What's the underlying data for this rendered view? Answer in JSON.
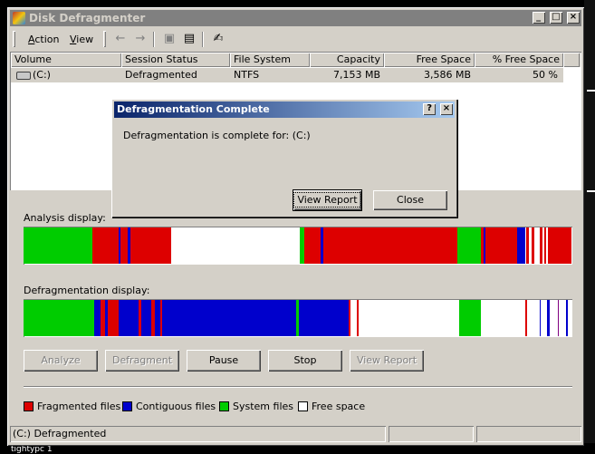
{
  "window": {
    "title": "Disk Defragmenter",
    "controls": [
      "_",
      "□",
      "×"
    ]
  },
  "menu": {
    "action": "Action",
    "view": "View"
  },
  "toolbar_icons": [
    "back-arrow-icon",
    "forward-arrow-icon",
    "folder-icon",
    "properties-icon",
    "help-icon"
  ],
  "list": {
    "columns": [
      "Volume",
      "Session Status",
      "File System",
      "Capacity",
      "Free Space",
      "% Free Space"
    ],
    "rows": [
      {
        "volume": "(C:)",
        "status": "Defragmented",
        "fs": "NTFS",
        "capacity": "7,153 MB",
        "free": "3,586 MB",
        "pct": "50 %"
      }
    ]
  },
  "analysis": {
    "label": "Analysis display:",
    "segments_note_percent": true,
    "segments": [
      [
        "#00cc00",
        0,
        12.5
      ],
      [
        "#dd0000",
        12.5,
        5
      ],
      [
        "#0000cc",
        17.3,
        0.4
      ],
      [
        "#dd0000",
        17.7,
        1.3
      ],
      [
        "#0000cc",
        19.0,
        0.4
      ],
      [
        "#dd0000",
        19.4,
        7.5
      ],
      [
        "#00cc00",
        50.4,
        0.7
      ],
      [
        "#dd0000",
        51.1,
        3.0
      ],
      [
        "#0000cc",
        54.1,
        0.6
      ],
      [
        "#dd0000",
        54.7,
        24.3
      ],
      [
        "#00cc00",
        79.0,
        4.4
      ],
      [
        "#dd0000",
        83.4,
        0.4
      ],
      [
        "#0000cc",
        83.8,
        0.4
      ],
      [
        "#dd0000",
        84.2,
        5.7
      ],
      [
        "#0000cc",
        89.9,
        1.5
      ],
      [
        "#dd0000",
        91.6,
        0.4
      ],
      [
        "#dd0000",
        92.6,
        0.4
      ],
      [
        "#dd0000",
        94.0,
        0.5
      ],
      [
        "#dd0000",
        94.9,
        0.3
      ],
      [
        "#dd0000",
        95.6,
        4.2
      ]
    ]
  },
  "defrag": {
    "label": "Defragmentation display:",
    "segments": [
      [
        "#00cc00",
        0,
        12.8
      ],
      [
        "#0000cc",
        12.8,
        1.2
      ],
      [
        "#dd0000",
        14.0,
        0.8
      ],
      [
        "#0000cc",
        14.8,
        0.6
      ],
      [
        "#dd0000",
        15.4,
        2.0
      ],
      [
        "#0000cc",
        17.4,
        3.5
      ],
      [
        "#dd0000",
        20.9,
        0.6
      ],
      [
        "#0000cc",
        21.5,
        1.8
      ],
      [
        "#dd0000",
        23.3,
        0.7
      ],
      [
        "#0000cc",
        24.0,
        0.9
      ],
      [
        "#dd0000",
        24.9,
        0.4
      ],
      [
        "#0000cc",
        25.3,
        24.3
      ],
      [
        "#00cc00",
        49.6,
        0.6
      ],
      [
        "#0000cc",
        50.2,
        9.0
      ],
      [
        "#dd0000",
        59.3,
        0.3
      ],
      [
        "#dd0000",
        60.8,
        0.3
      ],
      [
        "#00cc00",
        79.4,
        4.0
      ],
      [
        "#dd0000",
        91.4,
        0.3
      ],
      [
        "#0000cc",
        94.0,
        0.3
      ],
      [
        "#0000cc",
        95.4,
        0.5
      ],
      [
        "#800080",
        97.3,
        0.3
      ],
      [
        "#0000cc",
        98.8,
        0.4
      ]
    ]
  },
  "buttons": {
    "analyze": "Analyze",
    "defragment": "Defragment",
    "pause": "Pause",
    "stop": "Stop",
    "view_report": "View Report"
  },
  "legend": {
    "fragmented": {
      "label": "Fragmented files",
      "color": "#dd0000"
    },
    "contiguous": {
      "label": "Contiguous files",
      "color": "#0000cc"
    },
    "system": {
      "label": "System files",
      "color": "#00cc00"
    },
    "free": {
      "label": "Free space",
      "color": "#ffffff"
    }
  },
  "status": "(C:) Defragmented",
  "dialog": {
    "title": "Defragmentation Complete",
    "message": "Defragmentation is complete for: (C:)",
    "view_report": "View Report",
    "close": "Close",
    "controls": [
      "?",
      "×"
    ]
  },
  "desktop_text": "tightypc 1"
}
